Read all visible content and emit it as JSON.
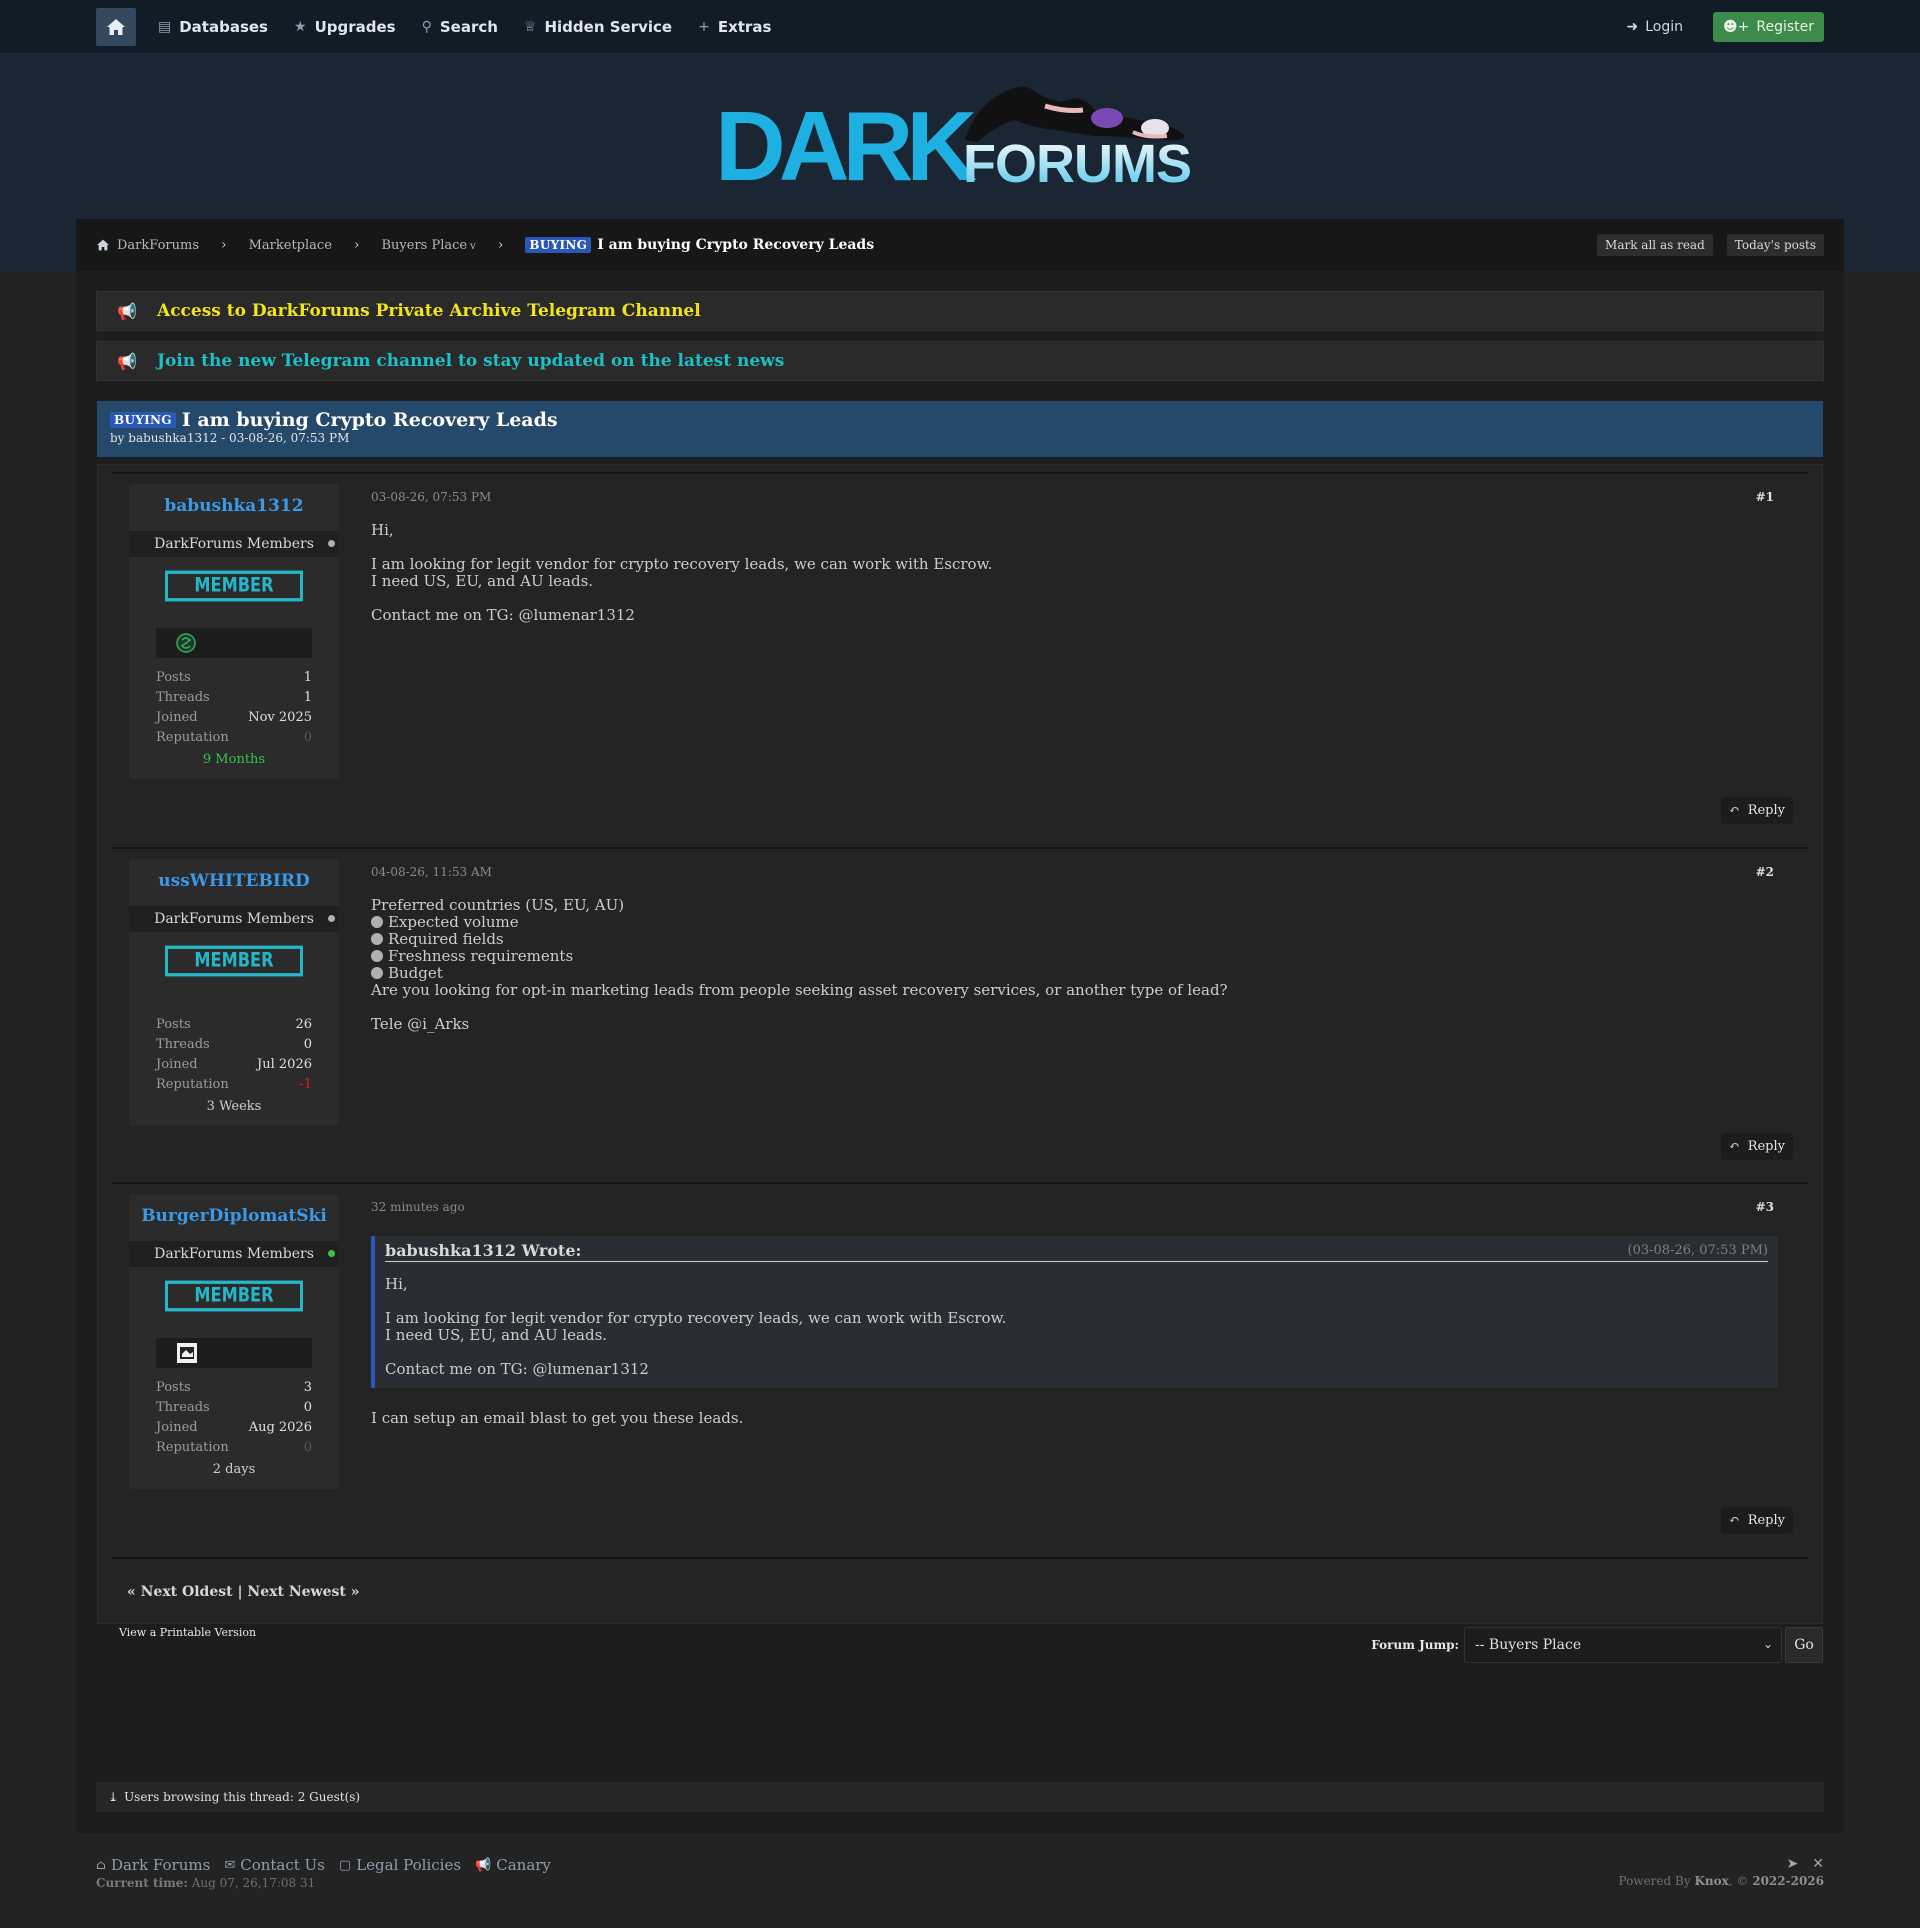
{
  "nav": {
    "items": [
      {
        "label": "Databases",
        "icon": "database-icon"
      },
      {
        "label": "Upgrades",
        "icon": "star-icon"
      },
      {
        "label": "Search",
        "icon": "search-icon"
      },
      {
        "label": "Hidden Service",
        "icon": "onion-icon"
      },
      {
        "label": "Extras",
        "icon": "plus-icon"
      }
    ],
    "login": "Login",
    "register": "Register"
  },
  "logo": {
    "dark": "DARK",
    "forums": "FORUMS"
  },
  "breadcrumb": {
    "items": [
      "DarkForums",
      "Marketplace",
      "Buyers Place"
    ],
    "current_tag": "BUYING",
    "current_title": "I am buying Crypto Recovery Leads",
    "mark_read": "Mark all as read",
    "todays_posts": "Today's posts"
  },
  "announcements": [
    {
      "text": "Access to DarkForums Private Archive Telegram Channel",
      "color": "#f2e41a"
    },
    {
      "text": "Join the new Telegram channel to stay updated on the latest news",
      "color": "#1bc1c8"
    }
  ],
  "thread": {
    "tag": "BUYING",
    "title": "I am buying Crypto Recovery Leads",
    "byline": "by babushka1312 - 03-08-26, 07:53 PM"
  },
  "posts": [
    {
      "author": "babushka1312",
      "group": "DarkForums Members",
      "badge": "MEMBER",
      "stats": {
        "posts_label": "Posts",
        "posts": "1",
        "threads_label": "Threads",
        "threads": "1",
        "joined_label": "Joined",
        "joined": "Nov 2025",
        "rep_label": "Reputation",
        "rep": "0"
      },
      "age": "9 Months",
      "date": "03-08-26, 07:53 PM",
      "num": "#1",
      "lines": [
        "Hi,",
        "I am looking for legit vendor for crypto recovery leads, we can work with Escrow.",
        "I need US, EU, and AU leads.",
        "Contact me on TG: @lumenar1312"
      ],
      "reply": "Reply"
    },
    {
      "author": "ussWHITEBIRD",
      "group": "DarkForums Members",
      "badge": "MEMBER",
      "stats": {
        "posts_label": "Posts",
        "posts": "26",
        "threads_label": "Threads",
        "threads": "0",
        "joined_label": "Joined",
        "joined": "Jul 2026",
        "rep_label": "Reputation",
        "rep": "-1"
      },
      "age": "3 Weeks",
      "date": "04-08-26, 11:53 AM",
      "num": "#2",
      "lines": [
        "Preferred countries (US, EU, AU)",
        "Expected volume",
        "Required fields",
        "Freshness requirements",
        "Budget",
        "Are you looking for opt-in marketing leads from people seeking asset recovery services, or another type of lead?",
        "Tele @i_Arks"
      ],
      "reply": "Reply"
    },
    {
      "author": "BurgerDiplomatSki",
      "group": "DarkForums Members",
      "badge": "MEMBER",
      "stats": {
        "posts_label": "Posts",
        "posts": "3",
        "threads_label": "Threads",
        "threads": "0",
        "joined_label": "Joined",
        "joined": "Aug 2026",
        "rep_label": "Reputation",
        "rep": "0"
      },
      "age": "2 days",
      "date": "32 minutes ago",
      "num": "#3",
      "quote": {
        "who": "babushka1312 Wrote:",
        "when": "(03-08-26, 07:53 PM)",
        "lines": [
          "Hi,",
          "I am looking for legit vendor for crypto recovery leads, we can work with Escrow.",
          "I need US, EU, and AU leads.",
          "Contact me on TG: @lumenar1312"
        ]
      },
      "lines": [
        "I can setup an email blast to get you these leads."
      ],
      "reply": "Reply"
    }
  ],
  "thread_nav": {
    "prev": "« Next Oldest",
    "divider": "|",
    "next": "Next Newest »"
  },
  "printable": "View a Printable Version",
  "forum_jump": {
    "label": "Forum Jump:",
    "selected": "-- Buyers Place",
    "go": "Go"
  },
  "browsing": "Users browsing this thread: 2 Guest(s)",
  "footer": {
    "links": [
      "Dark Forums",
      "Contact Us",
      "Legal Policies",
      "Canary"
    ],
    "time_label": "Current time:",
    "time_value": "Aug 07, 26,17:08 31",
    "powered_prefix": "Powered By",
    "powered_name": "Knox",
    "powered_suffix": ", ©",
    "years": "2022-2026"
  }
}
